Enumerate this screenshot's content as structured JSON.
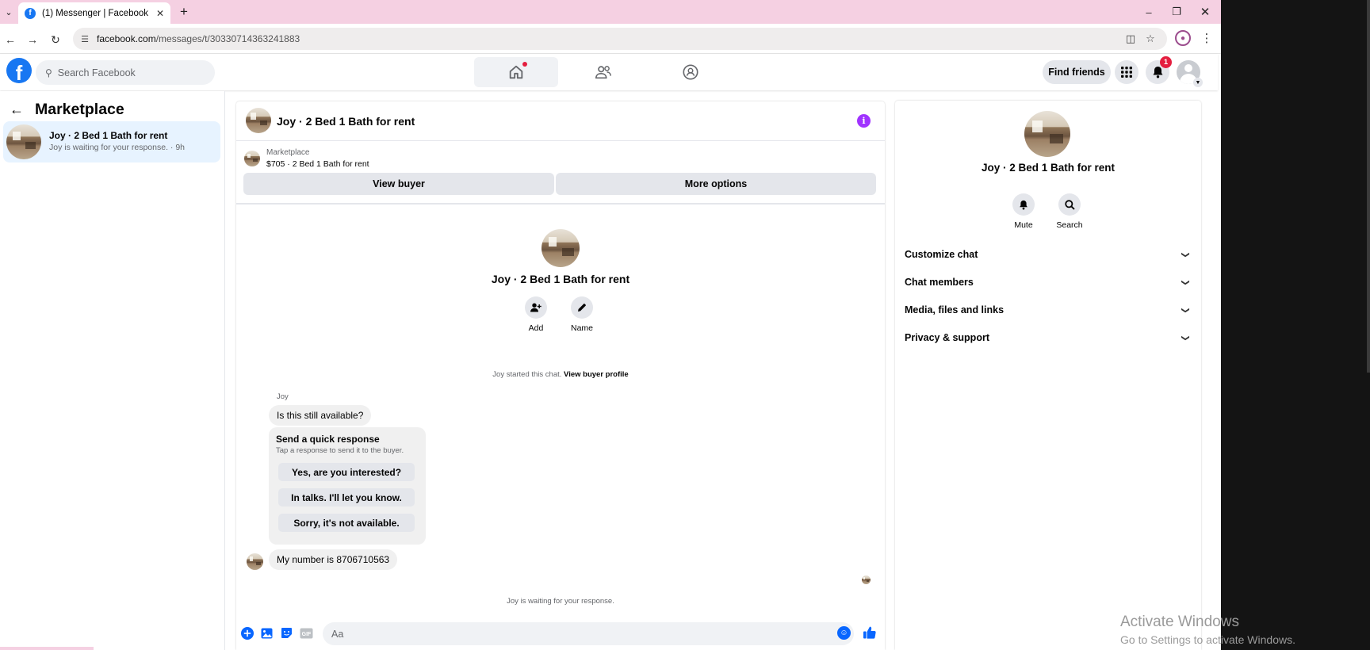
{
  "browser": {
    "tab_title": "(1) Messenger | Facebook",
    "url_domain": "facebook.com",
    "url_path": "/messages/t/30330714363241883"
  },
  "fb": {
    "search_placeholder": "Search Facebook",
    "find_friends": "Find friends",
    "notifications_count": "1"
  },
  "left": {
    "title": "Marketplace",
    "conversation": {
      "name": "Joy · 2 Bed 1 Bath for rent",
      "snippet": "Joy is waiting for your response. · 9h"
    }
  },
  "chat": {
    "title": "Joy · 2 Bed 1 Bath for rent",
    "listing_source": "Marketplace",
    "listing_desc": "$705 · 2 Bed 1 Bath for rent",
    "view_buyer": "View buyer",
    "more_options": "More options",
    "intro_name": "Joy · 2 Bed 1 Bath for rent",
    "add_label": "Add",
    "name_label": "Name",
    "started_text": "Joy started this chat.",
    "view_buyer_profile": "View buyer profile",
    "sender": "Joy",
    "message1": "Is this still available?",
    "quick_title": "Send a quick response",
    "quick_subtitle": "Tap a response to send it to the buyer.",
    "quick_replies": [
      "Yes, are you interested?",
      "In talks. I'll let you know.",
      "Sorry, it's not available."
    ],
    "message2": "My number is 8706710563",
    "waiting": "Joy is waiting for your response.",
    "composer_placeholder": "Aa"
  },
  "right": {
    "name": "Joy · 2 Bed 1 Bath for rent",
    "mute": "Mute",
    "search": "Search",
    "sections": [
      "Customize chat",
      "Chat members",
      "Media, files and links",
      "Privacy & support"
    ]
  },
  "windows": {
    "line1": "Activate Windows",
    "line2": "Go to Settings to activate Windows."
  },
  "colors": {
    "fb_blue": "#1877f2",
    "messenger_blue": "#0866ff",
    "info_purple": "#a033ff",
    "selected_conv": "#e7f3ff",
    "tabbar_pink": "#f5d0e2"
  },
  "icons": [
    "tab-list-icon",
    "facebook-favicon",
    "close-tab-icon",
    "new-tab-icon",
    "minimize-icon",
    "restore-icon",
    "close-window-icon",
    "back-icon",
    "forward-icon",
    "reload-icon",
    "site-info-icon",
    "install-icon",
    "star-icon",
    "profile-icon",
    "menu-icon",
    "search-icon",
    "home-icon",
    "friends-icon",
    "groups-icon",
    "apps-grid-icon",
    "bell-icon",
    "account-avatar",
    "back-arrow-icon",
    "info-icon",
    "add-person-icon",
    "pencil-icon",
    "plus-circle-icon",
    "image-icon",
    "sticker-icon",
    "gif-icon",
    "emoji-icon",
    "thumbs-up-icon",
    "chevron-down-icon"
  ]
}
